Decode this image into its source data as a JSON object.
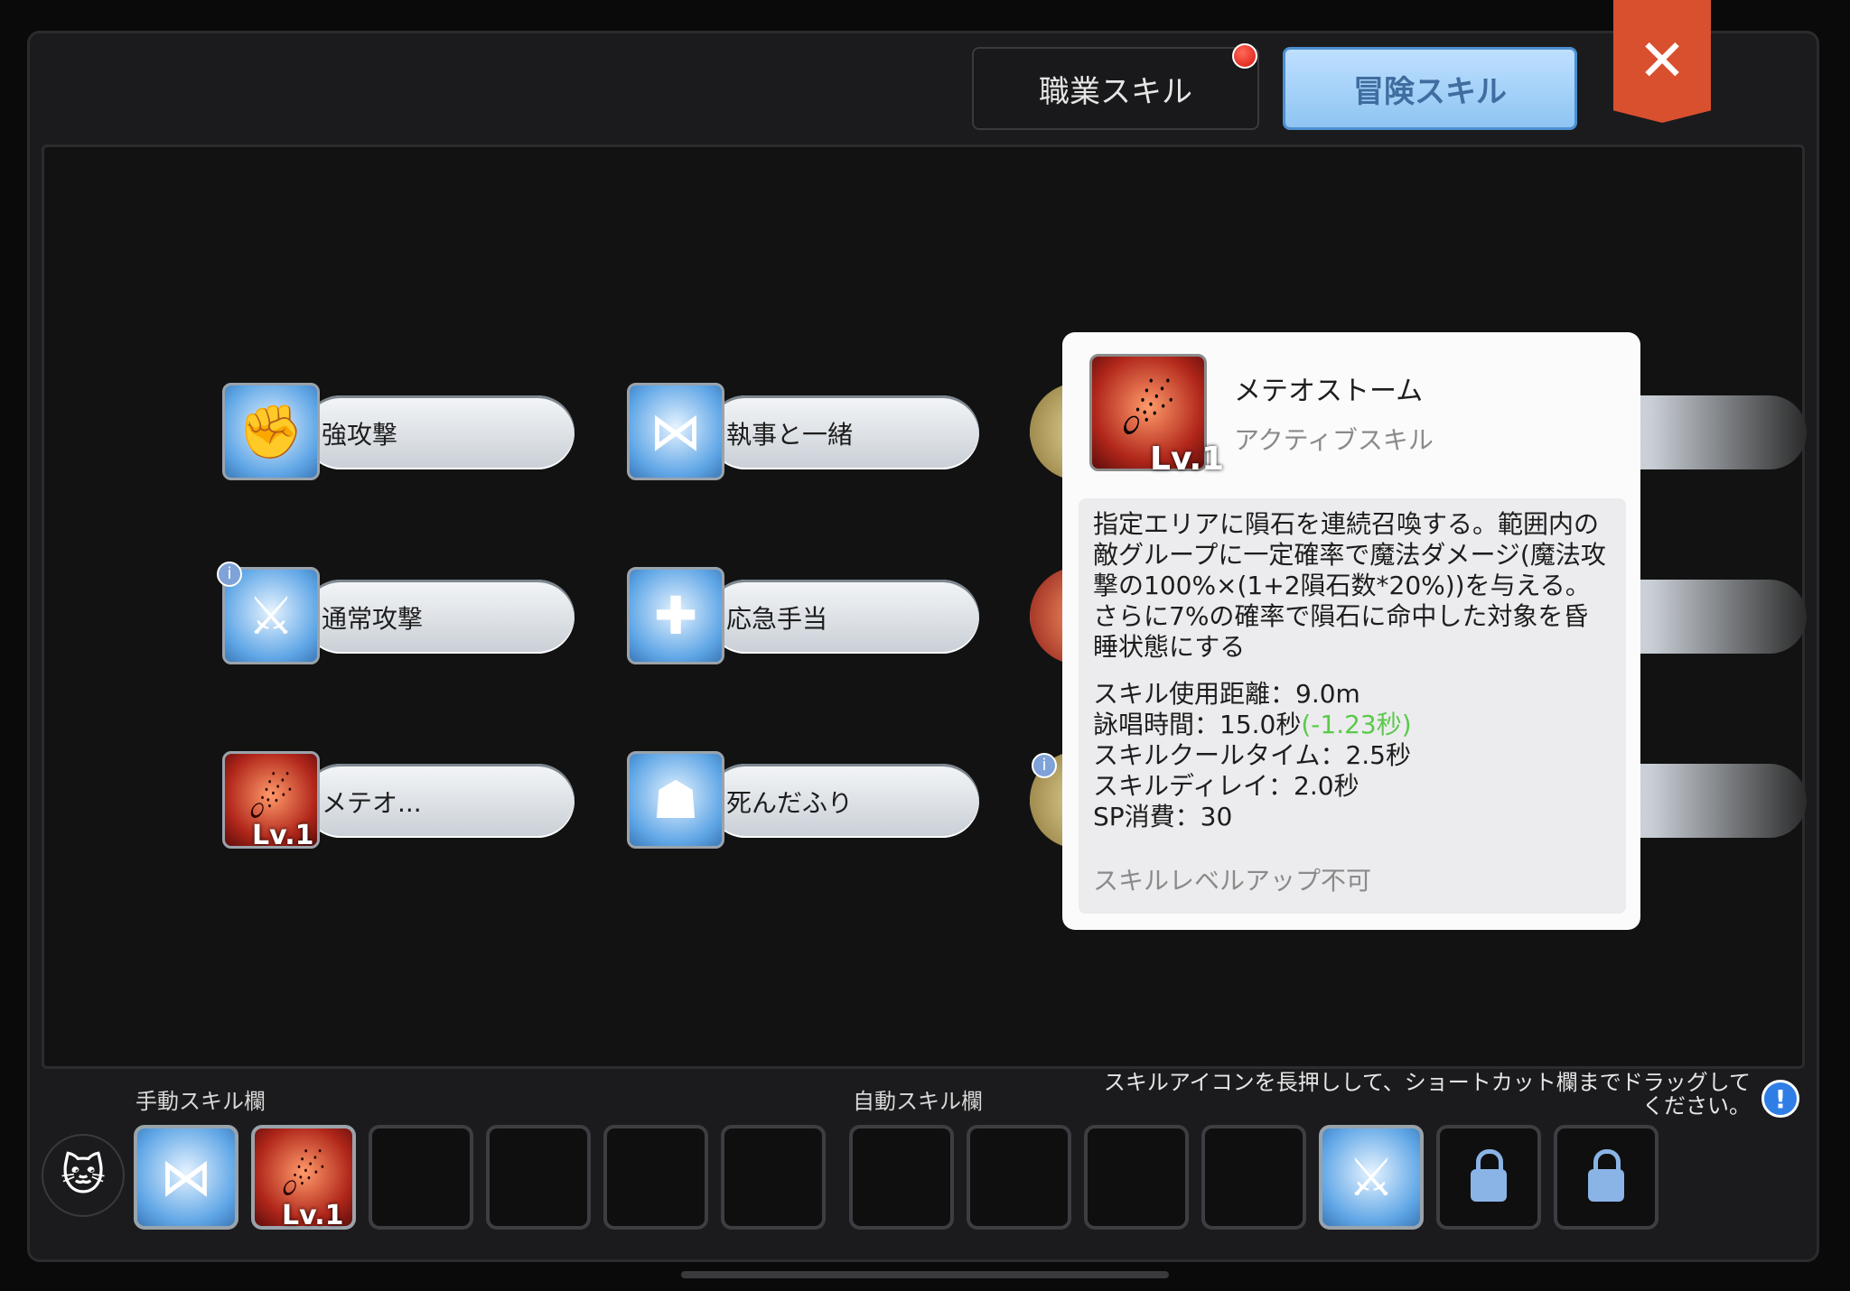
{
  "tabs": {
    "job_skill": "職業スキル",
    "adventure_skill": "冒険スキル"
  },
  "skills": [
    {
      "label": "強攻撃",
      "icon": "fist-icon"
    },
    {
      "label": "執事と一緒",
      "icon": "bowtie-icon"
    },
    {
      "label": "通常攻撃",
      "icon": "broken-sword-icon"
    },
    {
      "label": "応急手当",
      "icon": "first-aid-cross-icon"
    },
    {
      "label": "メテオ...",
      "icon": "meteor-icon",
      "level": "Lv.1"
    },
    {
      "label": "死んだふり",
      "icon": "play-dead-icon"
    }
  ],
  "tooltip": {
    "name": "メテオストーム",
    "type": "アクティブスキル",
    "level": "Lv.1",
    "description": "指定エリアに隕石を連続召喚する。範囲内の敵グループに一定確率で魔法ダメージ(魔法攻撃の100%×(1+2隕石数*20%))を与える。さらに7%の確率で隕石に命中した対象を昏睡状態にする",
    "stat_range": "スキル使用距離：9.0m",
    "stat_cast": "詠唱時間：15.0秒",
    "stat_cast_bonus": "(-1.23秒)",
    "stat_cooldown": "スキルクールタイム：2.5秒",
    "stat_delay": "スキルディレイ：2.0秒",
    "stat_sp": "SP消費：30",
    "note": "スキルレベルアップ不可"
  },
  "bar": {
    "manual_label": "手動スキル欄",
    "auto_label": "自動スキル欄",
    "hint": "スキルアイコンを長押しして、ショートカット欄までドラッグしてください。",
    "manual_slot_2_level": "Lv.1"
  },
  "colors": {
    "accent_blue": "#8ec4f3",
    "close_red": "#d9502e",
    "cast_bonus_green": "#5ac94a"
  }
}
